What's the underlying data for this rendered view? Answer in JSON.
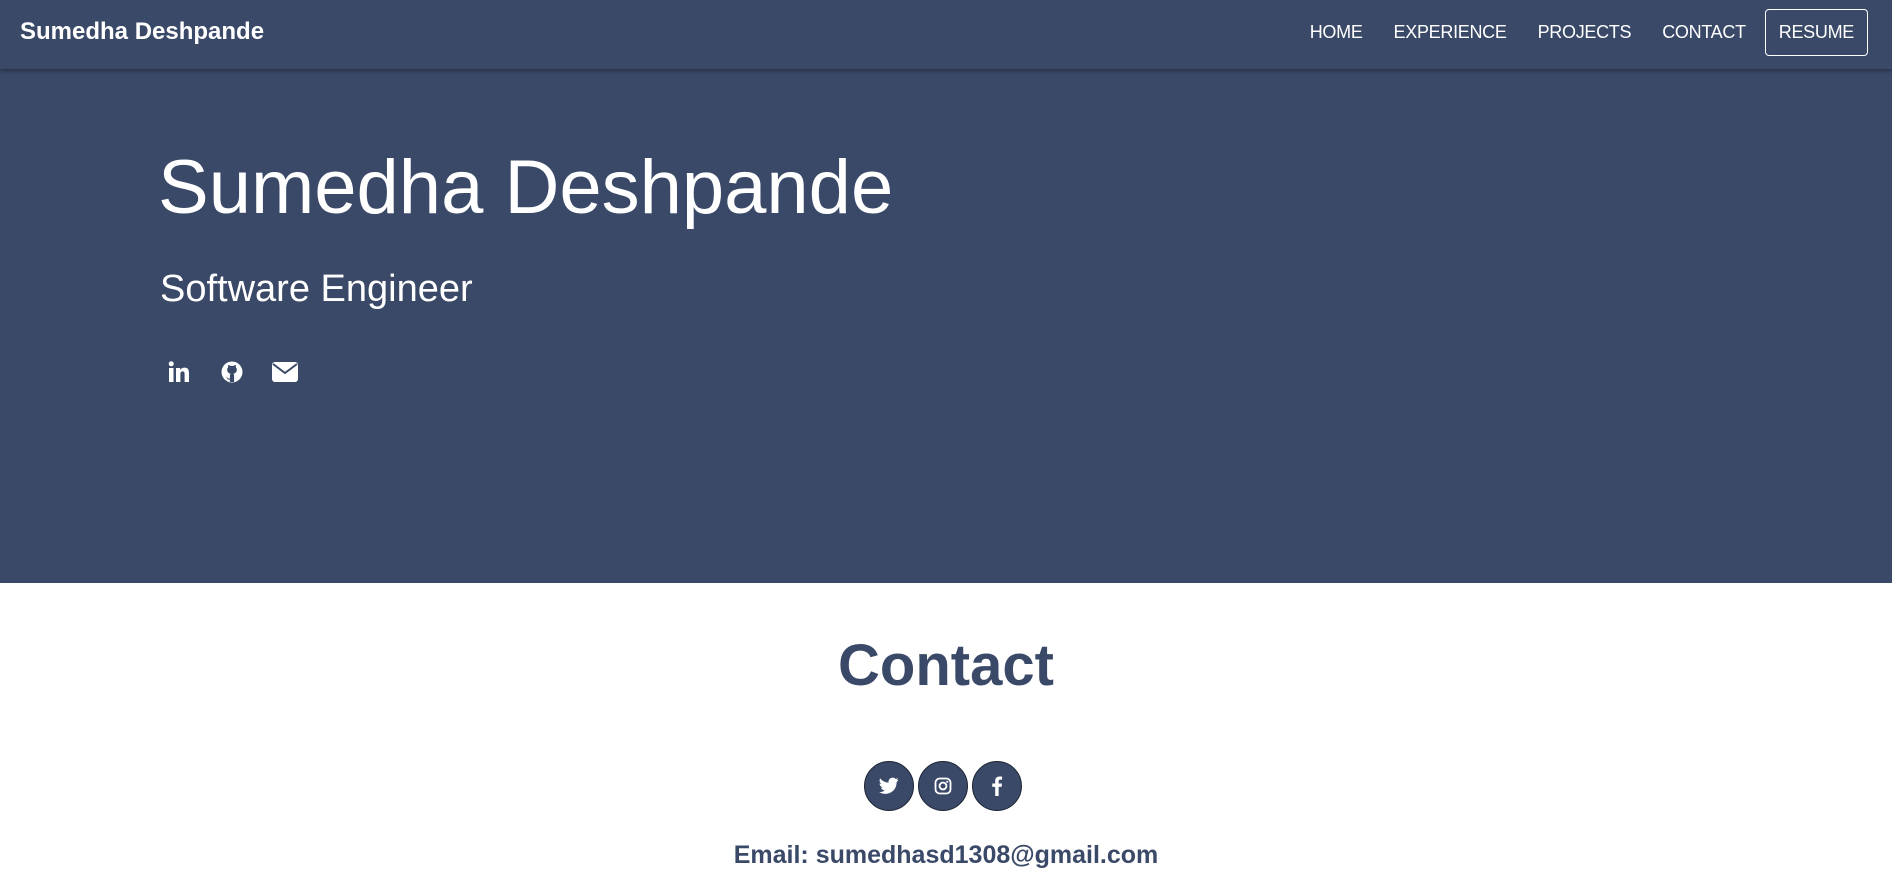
{
  "navbar": {
    "brand": "Sumedha Deshpande",
    "links": [
      "HOME",
      "EXPERIENCE",
      "PROJECTS",
      "CONTACT"
    ],
    "resume_label": "RESUME"
  },
  "hero": {
    "name": "Sumedha Deshpande",
    "title": "Software Engineer",
    "social_icons": [
      "linkedin-icon",
      "github-icon",
      "envelope-icon"
    ]
  },
  "contact": {
    "heading": "Contact",
    "social_icons": [
      "twitter-icon",
      "instagram-icon",
      "facebook-icon"
    ],
    "email_label": "Email:",
    "email": "sumedhasd1308@gmail.com"
  },
  "colors": {
    "primary": "#3a4968",
    "text_on_primary": "#ffffff",
    "background": "#ffffff"
  }
}
